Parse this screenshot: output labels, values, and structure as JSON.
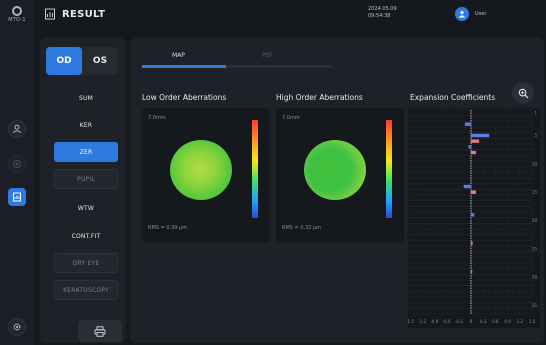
{
  "app": {
    "logo_text": "MTO-1",
    "title": "RESULT",
    "date": "2024.05.09",
    "time": "09:54:38",
    "user": "User"
  },
  "eye_toggle": {
    "od": "OD",
    "os": "OS",
    "selected": "OD"
  },
  "menu": [
    {
      "label": "SUM",
      "style": "plain"
    },
    {
      "label": "KER",
      "style": "plain"
    },
    {
      "label": "ZER",
      "style": "active"
    },
    {
      "label": "PUPIL",
      "style": "boxed"
    },
    {
      "label": "WTW",
      "style": "plain"
    },
    {
      "label": "CONT.FIT",
      "style": "plain"
    },
    {
      "label": "DRY EYE",
      "style": "boxed"
    },
    {
      "label": "KERATOSCOPY",
      "style": "boxed"
    }
  ],
  "tabs": {
    "map": "MAP",
    "psf": "PSF",
    "active": "MAP"
  },
  "low_order": {
    "title": "Low Order Aberrations",
    "diameter": "7.0mm",
    "rms": "RMS = 0.39 μm"
  },
  "high_order": {
    "title": "High Order Aberrations",
    "diameter": "7.0mm",
    "rms": "RMS = 0.32 μm"
  },
  "expansion": {
    "title": "Expansion Coefficients",
    "row_labels": [
      "1",
      "5",
      "10",
      "15",
      "20",
      "25",
      "30",
      "35"
    ],
    "axis_labels": [
      "-1.5",
      "-1.2",
      "-0.9",
      "-0.6",
      "-0.3",
      "0",
      "0.3",
      "0.6",
      "0.9",
      "1.2",
      "1.5"
    ]
  },
  "chart_data": {
    "type": "bar",
    "orientation": "horizontal",
    "title": "Expansion Coefficients",
    "xlim": [
      -1.5,
      1.5
    ],
    "coefficient_index": [
      3,
      5,
      6,
      7,
      8,
      14,
      15,
      19,
      24,
      29
    ],
    "values": [
      -0.15,
      0.45,
      0.2,
      -0.06,
      0.12,
      -0.18,
      0.12,
      0.08,
      0.04,
      0.03
    ],
    "colors": [
      "#5a7fe0",
      "#5a7fe0",
      "#e87a85",
      "#5a7fe0",
      "#e87a85",
      "#5a7fe0",
      "#e87a85",
      "#5a7fe0",
      "#e87a85",
      "#e87a85"
    ]
  },
  "colors": {
    "accent": "#2f7ae0",
    "background": "#15181d",
    "panel": "#1e2127",
    "positive_bar": "#e87a85",
    "negative_bar": "#5a7fe0"
  }
}
